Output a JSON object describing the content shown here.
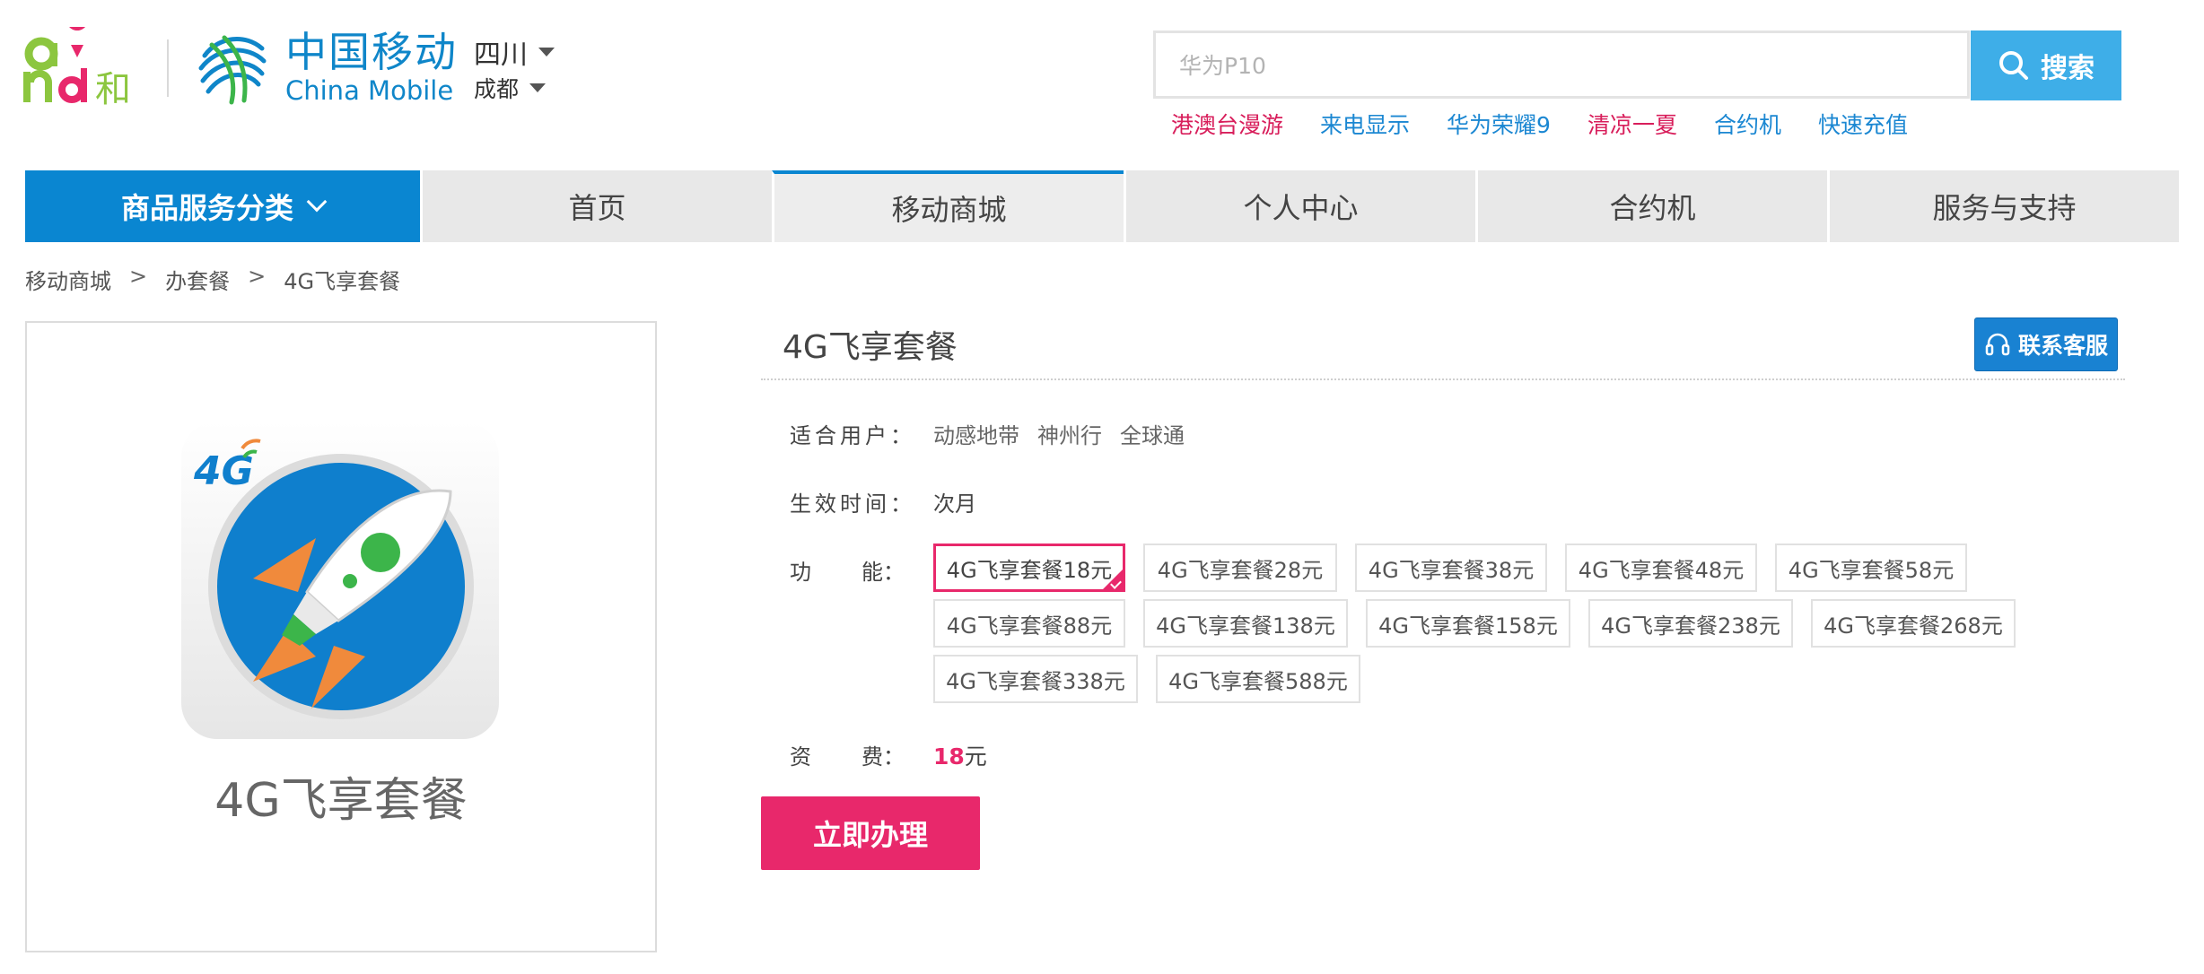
{
  "header": {
    "logo_and_text": "and和",
    "logo_cn": "中国移动",
    "logo_en": "China Mobile",
    "province": "四川",
    "city": "成都",
    "colors": {
      "brand_blue": "#0f86c9",
      "and_green": "#8cc63f",
      "and_pink": "#e8286b"
    }
  },
  "search": {
    "placeholder": "华为P10",
    "button_label": "搜索",
    "hotlinks": [
      {
        "label": "港澳台漫游",
        "color": "#d81e5b"
      },
      {
        "label": "来电显示",
        "color": "#1b87d2"
      },
      {
        "label": "华为荣耀9",
        "color": "#1b87d2"
      },
      {
        "label": "清凉一夏",
        "color": "#d81e5b"
      },
      {
        "label": "合约机",
        "color": "#1b87d2"
      },
      {
        "label": "快速充值",
        "color": "#1b87d2"
      }
    ]
  },
  "nav": {
    "category_label": "商品服务分类",
    "items": [
      "首页",
      "移动商城",
      "个人中心",
      "合约机",
      "服务与支持"
    ],
    "active_index": 1
  },
  "breadcrumb": [
    "移动商城",
    "办套餐",
    "4G飞享套餐"
  ],
  "product": {
    "image_badge": "4G",
    "caption": "4G飞享套餐",
    "title": "4G飞享套餐",
    "service_button": "联系客服",
    "users_label": "适合用户：",
    "users": [
      "动感地带",
      "神州行",
      "全球通"
    ],
    "effective_label": "生效时间：",
    "effective_value": "次月",
    "function_label_chars": [
      "功",
      "能："
    ],
    "options": [
      "4G飞享套餐18元",
      "4G飞享套餐28元",
      "4G飞享套餐38元",
      "4G飞享套餐48元",
      "4G飞享套餐58元",
      "4G飞享套餐88元",
      "4G飞享套餐138元",
      "4G飞享套餐158元",
      "4G飞享套餐238元",
      "4G飞享套餐268元",
      "4G飞享套餐338元",
      "4G飞享套餐588元"
    ],
    "selected_option_index": 0,
    "fee_label_chars": [
      "资",
      "费："
    ],
    "fee_amount": "18",
    "fee_unit": "元",
    "apply_button": "立即办理"
  }
}
